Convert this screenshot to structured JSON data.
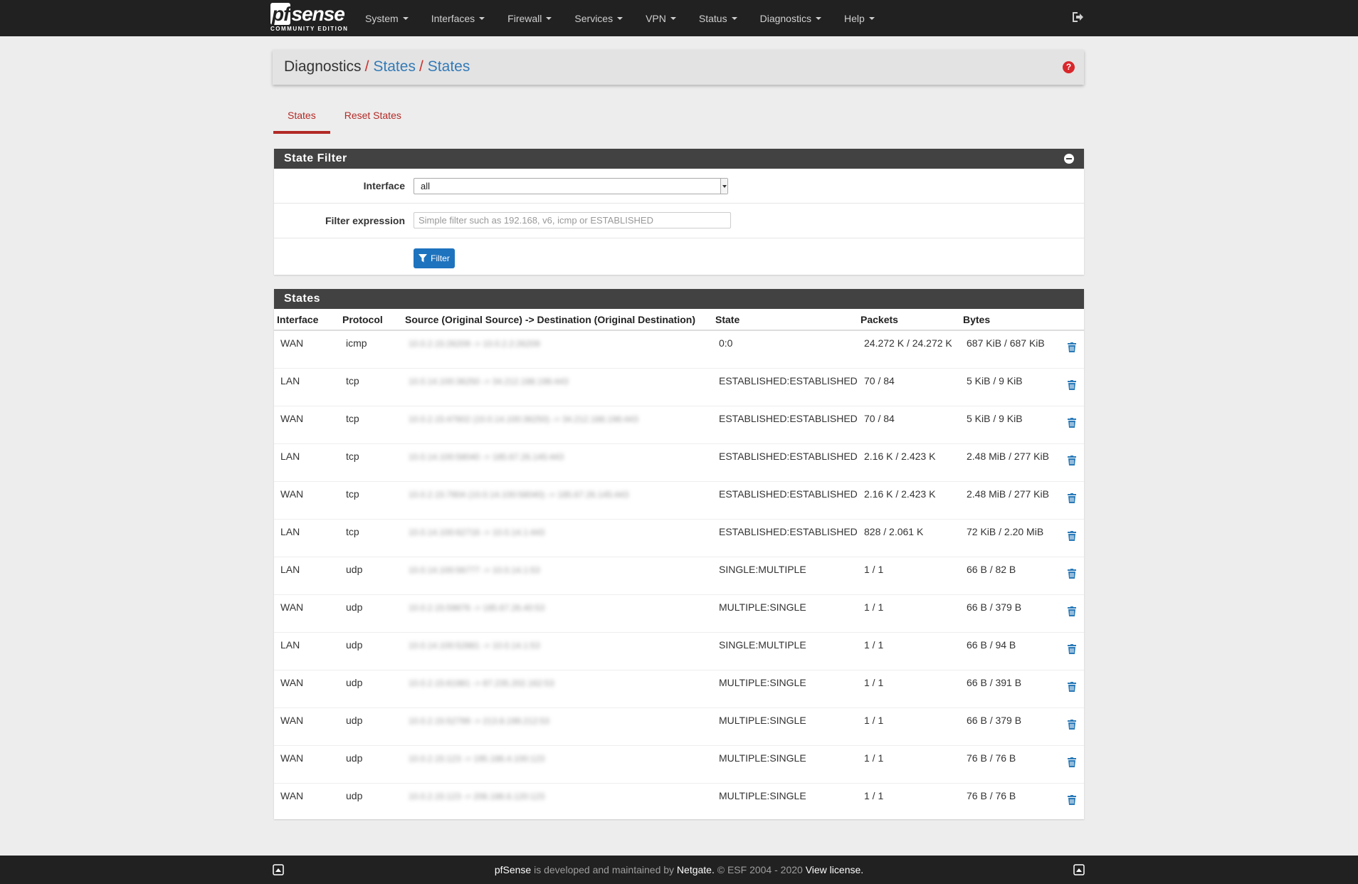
{
  "app": {
    "logo_text": "sense",
    "logo_pf": "pf",
    "logo_sub": "COMMUNITY EDITION"
  },
  "nav": {
    "items": [
      {
        "label": "System"
      },
      {
        "label": "Interfaces"
      },
      {
        "label": "Firewall"
      },
      {
        "label": "Services"
      },
      {
        "label": "VPN"
      },
      {
        "label": "Status"
      },
      {
        "label": "Diagnostics"
      },
      {
        "label": "Help"
      }
    ]
  },
  "breadcrumb": {
    "home": "Diagnostics",
    "sep1": "/",
    "link1": "States",
    "sep2": "/",
    "link2": "States",
    "help": "?"
  },
  "tabs": [
    {
      "label": "States",
      "active": true
    },
    {
      "label": "Reset States",
      "active": false
    }
  ],
  "filter_panel": {
    "title": "State Filter",
    "interface_label": "Interface",
    "interface_value": "all",
    "expression_label": "Filter expression",
    "expression_placeholder": "Simple filter such as 192.168, v6, icmp or ESTABLISHED",
    "filter_button": "Filter"
  },
  "states_panel": {
    "title": "States",
    "columns": [
      "Interface",
      "Protocol",
      "Source (Original Source) -> Destination (Original Destination)",
      "State",
      "Packets",
      "Bytes"
    ],
    "rows": [
      {
        "iface": "WAN",
        "proto": "icmp",
        "src": "10.0.2.15:26209 -> 10.0.2.2:26209",
        "state": "0:0",
        "packets": "24.272 K / 24.272 K",
        "bytes": "687 KiB / 687 KiB"
      },
      {
        "iface": "LAN",
        "proto": "tcp",
        "src": "10.0.14.100:36250 -> 34.212.188.196:443",
        "state": "ESTABLISHED:ESTABLISHED",
        "packets": "70 / 84",
        "bytes": "5 KiB / 9 KiB"
      },
      {
        "iface": "WAN",
        "proto": "tcp",
        "src": "10.0.2.15:47602 (10.0.14.100:36250) -> 34.212.188.196:443",
        "state": "ESTABLISHED:ESTABLISHED",
        "packets": "70 / 84",
        "bytes": "5 KiB / 9 KiB"
      },
      {
        "iface": "LAN",
        "proto": "tcp",
        "src": "10.0.14.100:58040 -> 185.67.26.145:443",
        "state": "ESTABLISHED:ESTABLISHED",
        "packets": "2.16 K / 2.423 K",
        "bytes": "2.48 MiB / 277 KiB"
      },
      {
        "iface": "WAN",
        "proto": "tcp",
        "src": "10.0.2.15:7904 (10.0.14.100:58040) -> 185.67.26.145:443",
        "state": "ESTABLISHED:ESTABLISHED",
        "packets": "2.16 K / 2.423 K",
        "bytes": "2.48 MiB / 277 KiB"
      },
      {
        "iface": "LAN",
        "proto": "tcp",
        "src": "10.0.14.100:62716 -> 10.0.14.1:443",
        "state": "ESTABLISHED:ESTABLISHED",
        "packets": "828 / 2.061 K",
        "bytes": "72 KiB / 2.20 MiB"
      },
      {
        "iface": "LAN",
        "proto": "udp",
        "src": "10.0.14.100:56777 -> 10.0.14.1:53",
        "state": "SINGLE:MULTIPLE",
        "packets": "1 / 1",
        "bytes": "66 B / 82 B"
      },
      {
        "iface": "WAN",
        "proto": "udp",
        "src": "10.0.2.15:59876 -> 185.67.26.40:53",
        "state": "MULTIPLE:SINGLE",
        "packets": "1 / 1",
        "bytes": "66 B / 379 B"
      },
      {
        "iface": "LAN",
        "proto": "udp",
        "src": "10.0.14.100:52881 -> 10.0.14.1:53",
        "state": "SINGLE:MULTIPLE",
        "packets": "1 / 1",
        "bytes": "66 B / 94 B"
      },
      {
        "iface": "WAN",
        "proto": "udp",
        "src": "10.0.2.15:61981 -> 87.235.202.162:53",
        "state": "MULTIPLE:SINGLE",
        "packets": "1 / 1",
        "bytes": "66 B / 391 B"
      },
      {
        "iface": "WAN",
        "proto": "udp",
        "src": "10.0.2.15:52799 -> 213.8.199.212:53",
        "state": "MULTIPLE:SINGLE",
        "packets": "1 / 1",
        "bytes": "66 B / 379 B"
      },
      {
        "iface": "WAN",
        "proto": "udp",
        "src": "10.0.2.15:123 -> 195.186.4.100:123",
        "state": "MULTIPLE:SINGLE",
        "packets": "1 / 1",
        "bytes": "76 B / 76 B"
      },
      {
        "iface": "WAN",
        "proto": "udp",
        "src": "10.0.2.15:123 -> 206.186.6.120:123",
        "state": "MULTIPLE:SINGLE",
        "packets": "1 / 1",
        "bytes": "76 B / 76 B"
      }
    ]
  },
  "footer": {
    "brand": "pfSense",
    "text1": " is developed and maintained by ",
    "company": "Netgate.",
    "text2": " © ESF 2004 - 2020 ",
    "license": "View license."
  },
  "colors": {
    "navbar": "#212121",
    "accent_red": "#b22a26",
    "link_blue": "#337ab7",
    "button_blue": "#1e73be",
    "trash_blue": "#2a7ab8"
  }
}
